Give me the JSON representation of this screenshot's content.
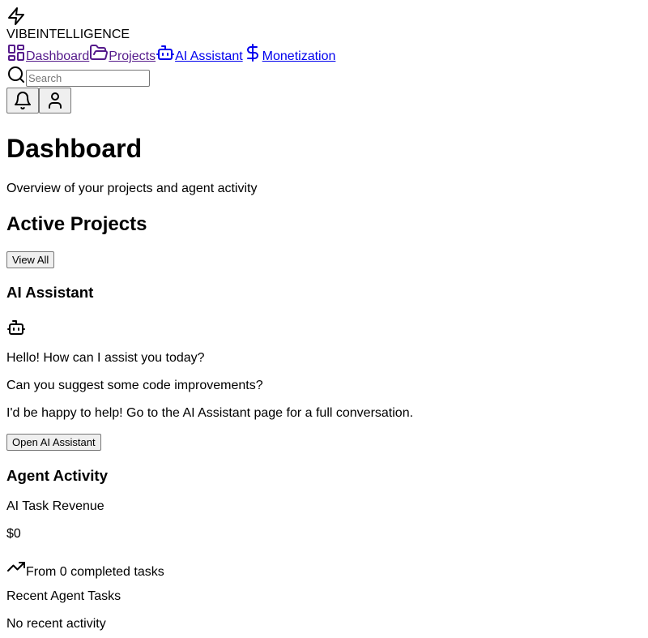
{
  "brand": {
    "name": "VIBEINTELLIGENCE",
    "icon": "zap-icon"
  },
  "nav": {
    "items": [
      {
        "label": "Dashboard",
        "icon": "layout-dashboard-icon"
      },
      {
        "label": "Projects",
        "icon": "folder-open-icon"
      },
      {
        "label": "AI Assistant",
        "icon": "bot-icon"
      },
      {
        "label": "Monetization",
        "icon": "dollar-sign-icon"
      }
    ]
  },
  "search": {
    "placeholder": "Search",
    "value": ""
  },
  "header_actions": {
    "notifications_icon": "bell-icon",
    "profile_icon": "user-icon"
  },
  "page": {
    "title": "Dashboard",
    "subtitle": "Overview of your projects and agent activity"
  },
  "active_projects": {
    "title": "Active Projects",
    "view_all_label": "View All"
  },
  "assistant": {
    "title": "AI Assistant",
    "icon": "bot-icon",
    "messages": [
      "Hello! How can I assist you today?",
      "Can you suggest some code improvements?",
      "I'd be happy to help! Go to the AI Assistant page for a full conversation."
    ],
    "open_label": "Open AI Assistant"
  },
  "agent_activity": {
    "title": "Agent Activity",
    "revenue_label": "AI Task Revenue",
    "revenue_value": "$0",
    "trend_icon": "trending-up-icon",
    "trend_text": "From 0 completed tasks",
    "recent_title": "Recent Agent Tasks",
    "recent_empty": "No recent activity"
  },
  "colors": {
    "link": "#0000ee",
    "visited_link": "#551a8b",
    "button_bg": "#efefef",
    "button_border": "#767676"
  }
}
